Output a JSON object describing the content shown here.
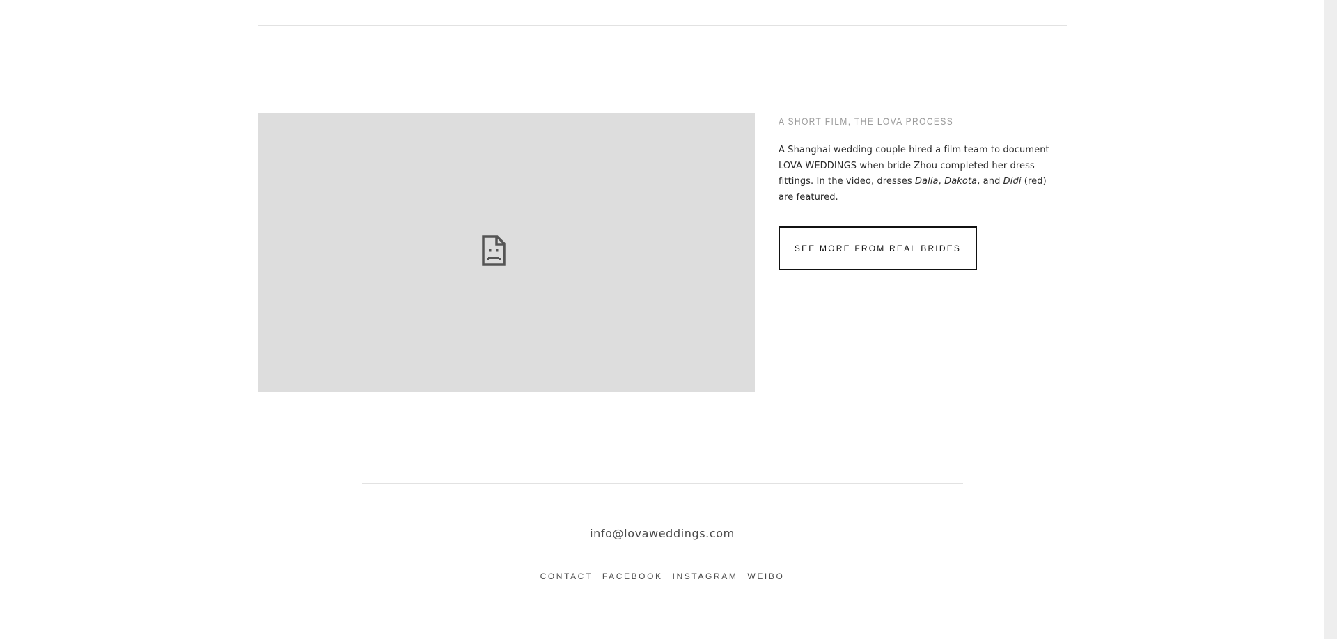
{
  "feature": {
    "heading": "A SHORT FILM, THE LOVA PROCESS",
    "body_lead": "A Shanghai wedding couple hired a film team to document LOVA WEDDINGS when bride Zhou completed her dress fittings. In the video, dresses ",
    "dress_1": "Dalia",
    "sep_1": ", ",
    "dress_2": "Dakota",
    "sep_2": ", and ",
    "dress_3": "Didi",
    "body_tail": " (red) are featured.",
    "button_label": "SEE MORE FROM REAL BRIDES"
  },
  "video": {
    "icon": "broken-page-icon"
  },
  "footer": {
    "email": "info@lovaweddings.com",
    "links": [
      "CONTACT",
      "FACEBOOK",
      "INSTAGRAM",
      "WEIBO"
    ]
  },
  "colors": {
    "video_placeholder": "#dddddd",
    "heading": "#9a9a9a",
    "rule": "#e2e2e2"
  }
}
